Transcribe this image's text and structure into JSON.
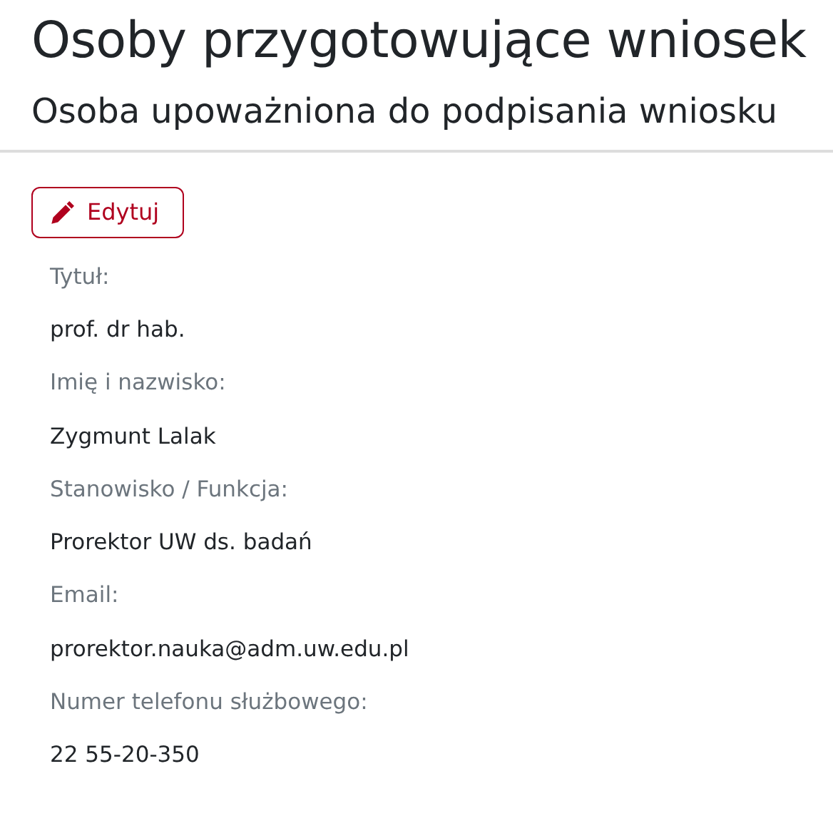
{
  "title": "Osoby przygotowujące wniosek",
  "subtitle": "Osoba upoważniona do podpisania wniosku",
  "edit_button": "Edytuj",
  "fields": [
    {
      "label": "Tytuł:",
      "value": "prof. dr hab."
    },
    {
      "label": "Imię i nazwisko:",
      "value": "Zygmunt Lalak"
    },
    {
      "label": "Stanowisko / Funkcja:",
      "value": "Prorektor UW ds. badań"
    },
    {
      "label": "Email:",
      "value": "prorektor.nauka@adm.uw.edu.pl"
    },
    {
      "label": "Numer telefonu służbowego:",
      "value": "22 55-20-350"
    }
  ]
}
